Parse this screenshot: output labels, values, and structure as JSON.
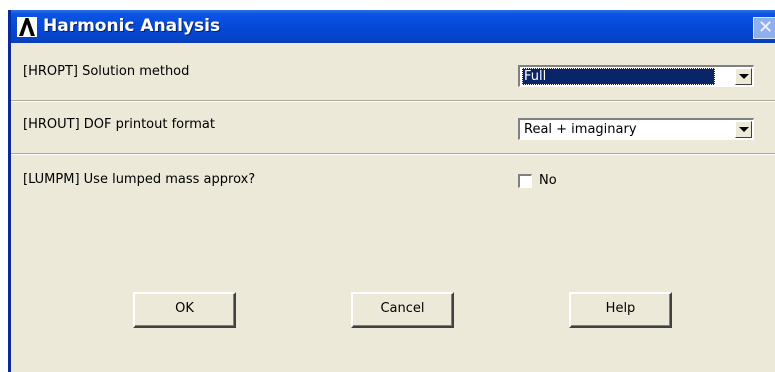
{
  "window": {
    "title": "Harmonic Analysis",
    "close_glyph": "✕",
    "app_icon": "ansys-lambda-icon"
  },
  "fields": {
    "hropt": {
      "label": "[HROPT]  Solution method",
      "selected_value": "Full"
    },
    "hrout": {
      "label": "[HROUT]  DOF printout format",
      "selected_value": "Real + imaginary"
    },
    "lumpm": {
      "label": "[LUMPM]  Use lumped mass approx?",
      "checked": false,
      "checkbox_label": "No"
    }
  },
  "buttons": {
    "ok_label": "OK",
    "cancel_label": "Cancel",
    "help_label": "Help"
  },
  "colors": {
    "titlebar": "#0548d6",
    "dialog_background": "#ece9d8",
    "selection": "#0a246a"
  }
}
